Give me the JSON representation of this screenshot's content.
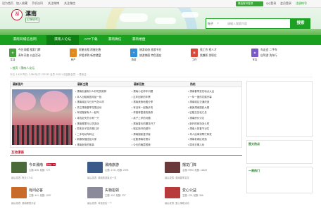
{
  "topbar": {
    "links": [
      "设为首页",
      "加入收藏",
      "手机访问",
      "关注微博",
      "关注微信"
    ],
    "wechat_login": "微信账号登录",
    "qq_login": "QQ登录",
    "member_login": "会员登录",
    "register": "注册帐号"
  },
  "header": {
    "city": "漯南",
    "logo_text": "湖",
    "switch_city": "[切换城市]",
    "search_tag": "帖子",
    "search_placeholder": "请输入搜索内容",
    "search_button": "搜索"
  },
  "nav": {
    "items": [
      "漯南同城信息网",
      "漯南人论坛",
      "APP下载",
      "漯南微信",
      "漯南楼盘"
    ]
  },
  "quick": [
    {
      "label": "生活",
      "color": "#4aa23f",
      "links": [
        "今日采暖",
        "搜索门牌",
        "青年开放",
        "公益活动"
      ]
    },
    {
      "label": "房产",
      "color": "#e08a1e",
      "links": [
        "房屋出租",
        "房屋出售",
        "求租求购",
        "新房楼盘"
      ]
    },
    {
      "label": "旅游",
      "color": "#2f8fd8",
      "links": [
        "旅游动态",
        "旅游节日",
        "旅游美图",
        "特色酒店"
      ]
    },
    {
      "label": "工作",
      "color": "#d84a3a",
      "links": [
        "找工作",
        "招人才",
        "找兼职",
        "发职位"
      ]
    },
    {
      "label": "车友",
      "color": "#7a5ac8",
      "links": [
        "车友会",
        "二手车",
        "自驾游",
        "洗车行"
      ]
    }
  ],
  "breadcrumb": {
    "home": "首页",
    "sep": " › ",
    "current": "漯南人论坛"
  },
  "stats": "今日: 1,432   昨日: 2,386   帖子: 222133   会员: 53121   欢迎新会员: 一笑而过~",
  "main": {
    "col_headers": [
      "最新图片",
      "最新主题",
      "最新回复",
      "热帖"
    ],
    "new_topics": [
      "• 漯南街道有什么好吃的推荐",
      "• 本人出租家居用品一批",
      "• 漯南城区今日天气怎么样",
      "• 关注漯南春季花展活动",
      "• 年前搬家有人一起吗",
      "• 寻找走失的小狗一只",
      "• 漯南哪里可以学游泳",
      "• 周末亲子游去哪儿好",
      "• 二手电动车转让",
      "• 新春祝福送给大家",
      "• 漯南老街的故事"
    ],
    "new_replies": [
      "• 漯南小区停车问题",
      "• 过年回家的车票",
      "• 漯南美食地图分享",
      "• 有没有一起跑步的",
      "• 求推荐靠谱的装修",
      "• 孩子上学的问题",
      "• 漯南春天的樱花开了",
      "• 城区新开的超市",
      "• 漯南摄影爱好者",
      "• 征集漯南老照片",
      "• 今天的晚霞很美"
    ],
    "hot": [
      "• 漯南春季赏花地点大全",
      "• 一年一度的花展开幕",
      "• 漯南城区交通改造",
      "• 最美漯南摄影大赛",
      "• 征婚交友帖汇总",
      "• 漯南房价讨论",
      "• 新开的商场怎么样",
      "• 漯南人的春节记忆",
      "• 寻人启事请帮忙转发",
      "• 漯南老城区改造",
      "• 周末去哪儿玩"
    ]
  },
  "sidebar": {
    "box1_title": "",
    "box2_title": "图文热点",
    "box3_title": "一周热门"
  },
  "hudong": {
    "title": "互动漯南"
  },
  "cards": [
    {
      "name": "今日漯南",
      "meta": "主题: 635, 帖数: 773",
      "last": "最后发表: 昨天 17:41",
      "color": "#4a6a3a",
      "newtag": "新帖: 12"
    },
    {
      "name": "漯南旅游",
      "meta": "主题: 1741, 帖数: 2375",
      "last": "最后发表: 漯南旅游景点一览",
      "color": "#3a5a8a"
    },
    {
      "name": "摆龙门阵",
      "meta": "主题: 9994, 帖数: 11823",
      "last": "最后发表: 漯南春季赏花",
      "color": "#6a3a3a"
    },
    {
      "name": "有问必答",
      "meta": "主题: 441, 帖数: 1097",
      "last": "最后发表: 漯南哪里办证",
      "color": "#c86a2a"
    },
    {
      "name": "失物招领",
      "meta": "主题: 192, 帖数: 237",
      "last": "最后发表: 寻找钱包一个",
      "color": "#8a8a9a"
    },
    {
      "name": "爱心公益",
      "meta": "主题: 125, 帖数: 366",
      "last": "最后发表: 爱心捐助活动",
      "color": "#b83a3a"
    }
  ]
}
